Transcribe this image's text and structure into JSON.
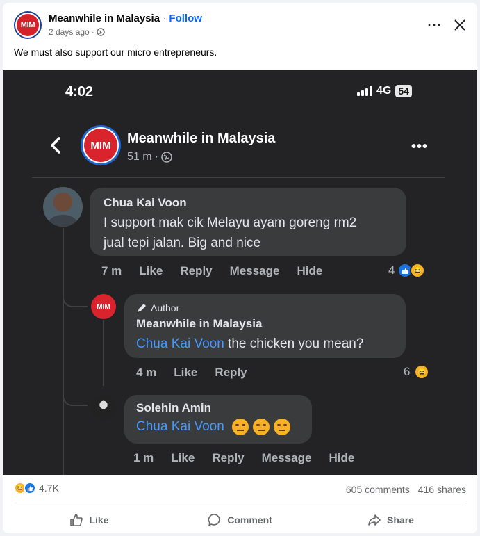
{
  "post": {
    "page_name": "Meanwhile in Malaysia",
    "dot": "·",
    "follow": "Follow",
    "time": "2 days ago",
    "meta_sep": "·",
    "caption": "We must also support our micro entrepreneurs.",
    "logo_text": "MIM"
  },
  "phone": {
    "time": "4:02",
    "network": "4G",
    "battery": "54",
    "page_name": "Meanwhile in Malaysia",
    "age": "51 m",
    "meta_sep": "·",
    "logo_text": "MIM"
  },
  "comments": [
    {
      "author": "Chua Kai Voon",
      "line1": "I support mak cik Melayu ayam goreng rm2",
      "line2": "jual tepi jalan. Big and nice",
      "time": "7 m",
      "like": "Like",
      "reply": "Reply",
      "message": "Message",
      "hide": "Hide",
      "reactions": "4"
    },
    {
      "badge": "Author",
      "author": "Meanwhile in Malaysia",
      "mention": "Chua Kai Voon",
      "text": " the chicken you mean?",
      "time": "4 m",
      "like": "Like",
      "reply": "Reply",
      "reactions": "6",
      "logo_text": "MIM"
    },
    {
      "author": "Solehin Amin",
      "mention": "Chua Kai Voon",
      "time": "1 m",
      "like": "Like",
      "reply": "Reply",
      "message": "Message",
      "hide": "Hide"
    }
  ],
  "stats": {
    "reactions": "4.7K",
    "comments": "605 comments",
    "shares": "416 shares"
  },
  "actions": {
    "like": "Like",
    "comment": "Comment",
    "share": "Share"
  }
}
